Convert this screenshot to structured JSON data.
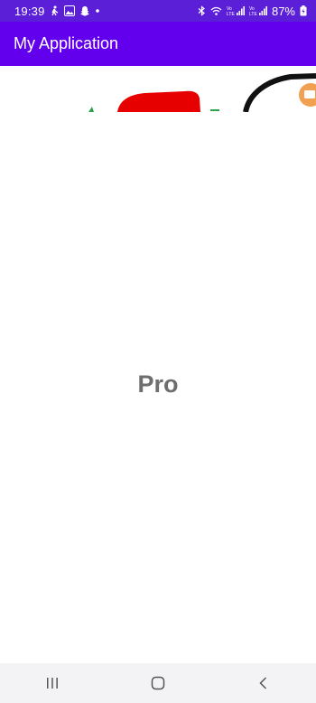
{
  "status_bar": {
    "time": "19:39",
    "battery": "87%",
    "network_label_1": "VoLTE1",
    "network_label_2": "VoLTE2",
    "background": "#5b1fd8"
  },
  "app_bar": {
    "title": "My Application",
    "background": "#6200ee"
  },
  "main": {
    "center_text": "Pro",
    "text_color": "#6e6e6e"
  },
  "banner": {
    "image_colors": [
      "#e60000",
      "#111111",
      "#f0a050",
      "#2aa34a"
    ]
  },
  "nav_bar": {
    "buttons": [
      "recent-apps-icon",
      "home-icon",
      "back-icon"
    ]
  }
}
